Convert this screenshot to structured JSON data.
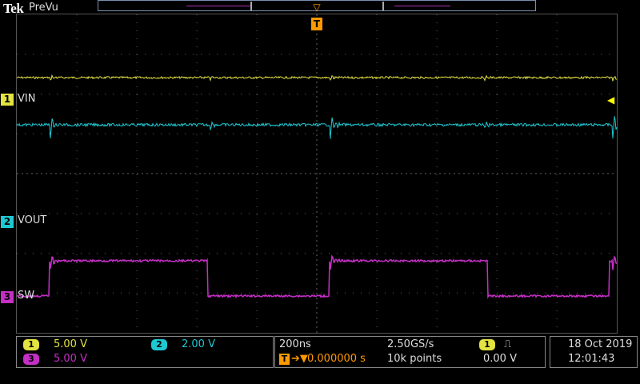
{
  "header": {
    "brand": "Tek",
    "acq_state": "PreVu"
  },
  "trigger": {
    "marker": "T",
    "position_icon": "T-arrow-icon"
  },
  "channels": [
    {
      "num": "1",
      "label": "VIN",
      "scale": "5.00 V",
      "color": "#e3e342"
    },
    {
      "num": "2",
      "label": "VOUT",
      "scale": "2.00 V",
      "color": "#1ec8d2"
    },
    {
      "num": "3",
      "label": "SW",
      "scale": "5.00 V",
      "color": "#c52fc5"
    }
  ],
  "horizontal": {
    "time_per_div": "200ns",
    "sample_rate": "2.50GS/s",
    "trigger_pos_icon": "T",
    "trigger_delay": "0.000000 s",
    "record_length": "10k points"
  },
  "trigger_info": {
    "source": "1",
    "slope_icon": "rising-edge-icon",
    "slope_glyph": "⎍",
    "level": "0.00 V"
  },
  "datetime": {
    "date": "18 Oct  2019",
    "time": "12:01:43"
  }
}
